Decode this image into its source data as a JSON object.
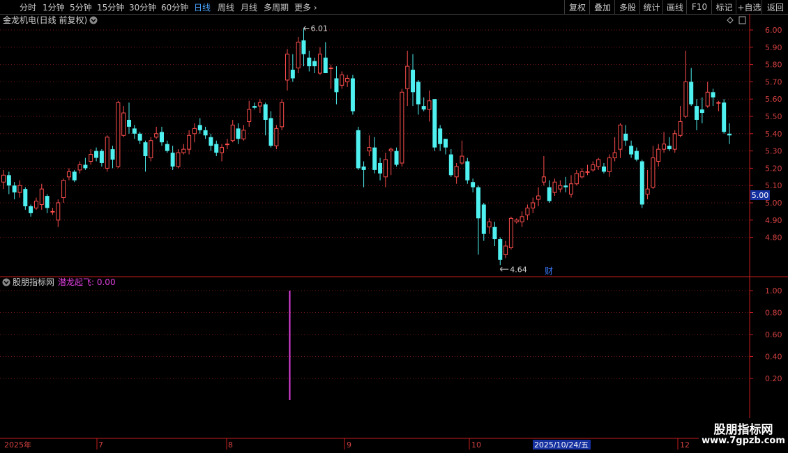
{
  "toolbar": {
    "periods": [
      "分时",
      "1分钟",
      "5分钟",
      "15分钟",
      "30分钟",
      "60分钟",
      "日线",
      "周线",
      "月线",
      "多周期"
    ],
    "active_period": "日线",
    "more_label": "更多",
    "actions": [
      "复权",
      "叠加",
      "多股",
      "统计",
      "画线",
      "F10",
      "标记",
      "+自选",
      "返回"
    ]
  },
  "main_panel": {
    "title": "金龙机电(日线 前复权)",
    "high_marker": "6.01",
    "low_marker": "4.64",
    "price_tag": "5.00",
    "finance_badge": "财"
  },
  "indicator_panel": {
    "title": "股朋指标网",
    "indicator_label": "潜龙起飞: 0.00",
    "indicator_color": "#e040e0"
  },
  "time_axis": {
    "labels": [
      "2025年",
      "7",
      "8",
      "9",
      "10",
      "12"
    ],
    "cursor_date": "2025/10/24/五"
  },
  "watermark": {
    "line1": "股朋指标网",
    "line2": "www.7gpzb.com"
  },
  "colors": {
    "up": "#ff4d4d",
    "down": "#4ff0f0",
    "axis_red": "#c81e1e",
    "grid": "#7a1a1a",
    "active_tab": "#4aa3ff"
  },
  "chart_data": [
    {
      "type": "candlestick",
      "title": "金龙机电(日线 前复权)",
      "y_ticks": [
        6.0,
        5.9,
        5.8,
        5.7,
        5.6,
        5.5,
        5.4,
        5.3,
        5.2,
        5.1,
        5.0,
        4.9,
        4.8
      ],
      "ylim": [
        4.61,
        6.03
      ],
      "annotations": [
        {
          "label": "6.01",
          "type": "high"
        },
        {
          "label": "4.64",
          "type": "low"
        }
      ],
      "candles": [
        [
          5.12,
          5.16,
          5.19,
          5.08
        ],
        [
          5.16,
          5.1,
          5.18,
          5.05
        ],
        [
          5.1,
          5.06,
          5.12,
          5.02
        ],
        [
          5.06,
          5.1,
          5.13,
          5.03
        ],
        [
          5.08,
          4.98,
          5.09,
          4.96
        ],
        [
          4.98,
          4.94,
          4.99,
          4.92
        ],
        [
          4.97,
          5.01,
          5.03,
          4.96
        ],
        [
          4.99,
          5.08,
          5.11,
          4.96
        ],
        [
          5.04,
          4.97,
          5.05,
          4.94
        ],
        [
          4.95,
          4.95,
          4.97,
          4.93
        ],
        [
          4.9,
          5.0,
          5.02,
          4.86
        ],
        [
          5.03,
          5.13,
          5.14,
          5.0
        ],
        [
          5.15,
          5.18,
          5.2,
          5.13
        ],
        [
          5.18,
          5.13,
          5.19,
          5.12
        ],
        [
          5.19,
          5.22,
          5.24,
          5.17
        ],
        [
          5.22,
          5.2,
          5.26,
          5.19
        ],
        [
          5.24,
          5.28,
          5.31,
          5.22
        ],
        [
          5.3,
          5.26,
          5.32,
          5.24
        ],
        [
          5.3,
          5.23,
          5.31,
          5.21
        ],
        [
          5.2,
          5.38,
          5.39,
          5.18
        ],
        [
          5.31,
          5.25,
          5.33,
          5.2
        ],
        [
          5.21,
          5.58,
          5.59,
          5.2
        ],
        [
          5.39,
          5.52,
          5.56,
          5.38
        ],
        [
          5.48,
          5.44,
          5.58,
          5.4
        ],
        [
          5.43,
          5.4,
          5.45,
          5.37
        ],
        [
          5.4,
          5.36,
          5.41,
          5.34
        ],
        [
          5.35,
          5.27,
          5.36,
          5.18
        ],
        [
          5.26,
          5.36,
          5.38,
          5.24
        ],
        [
          5.38,
          5.4,
          5.44,
          5.37
        ],
        [
          5.41,
          5.35,
          5.44,
          5.33
        ],
        [
          5.34,
          5.3,
          5.36,
          5.29
        ],
        [
          5.29,
          5.21,
          5.33,
          5.19
        ],
        [
          5.21,
          5.29,
          5.31,
          5.2
        ],
        [
          5.29,
          5.31,
          5.34,
          5.28
        ],
        [
          5.31,
          5.39,
          5.42,
          5.28
        ],
        [
          5.4,
          5.43,
          5.46,
          5.35
        ],
        [
          5.45,
          5.42,
          5.49,
          5.4
        ],
        [
          5.42,
          5.39,
          5.44,
          5.37
        ],
        [
          5.38,
          5.33,
          5.4,
          5.3
        ],
        [
          5.34,
          5.29,
          5.36,
          5.27
        ],
        [
          5.29,
          5.32,
          5.34,
          5.24
        ],
        [
          5.34,
          5.34,
          5.37,
          5.31
        ],
        [
          5.36,
          5.45,
          5.48,
          5.35
        ],
        [
          5.43,
          5.37,
          5.46,
          5.34
        ],
        [
          5.37,
          5.42,
          5.45,
          5.36
        ],
        [
          5.47,
          5.54,
          5.59,
          5.44
        ],
        [
          5.56,
          5.55,
          5.58,
          5.54
        ],
        [
          5.56,
          5.58,
          5.6,
          5.52
        ],
        [
          5.57,
          5.48,
          5.58,
          5.39
        ],
        [
          5.49,
          5.33,
          5.53,
          5.32
        ],
        [
          5.33,
          5.43,
          5.45,
          5.31
        ],
        [
          5.44,
          5.58,
          5.6,
          5.42
        ],
        [
          5.71,
          5.86,
          5.89,
          5.65
        ],
        [
          5.77,
          5.72,
          5.86,
          5.7
        ],
        [
          5.78,
          5.93,
          5.96,
          5.75
        ],
        [
          5.94,
          5.86,
          6.01,
          5.79
        ],
        [
          5.84,
          5.79,
          5.88,
          5.76
        ],
        [
          5.82,
          5.79,
          5.84,
          5.75
        ],
        [
          5.75,
          5.86,
          5.9,
          5.74
        ],
        [
          5.84,
          5.75,
          5.93,
          5.75
        ],
        [
          5.78,
          5.78,
          5.8,
          5.66
        ],
        [
          5.72,
          5.64,
          5.79,
          5.57
        ],
        [
          5.68,
          5.74,
          5.76,
          5.66
        ],
        [
          5.7,
          5.72,
          5.74,
          5.67
        ],
        [
          5.72,
          5.53,
          5.74,
          5.51
        ],
        [
          5.42,
          5.2,
          5.44,
          5.19
        ],
        [
          5.21,
          5.19,
          5.24,
          5.09
        ],
        [
          5.3,
          5.32,
          5.39,
          5.27
        ],
        [
          5.32,
          5.19,
          5.38,
          5.17
        ],
        [
          5.23,
          5.17,
          5.26,
          5.13
        ],
        [
          5.15,
          5.25,
          5.29,
          5.09
        ],
        [
          5.3,
          5.31,
          5.32,
          5.16
        ],
        [
          5.3,
          5.22,
          5.32,
          5.21
        ],
        [
          5.23,
          5.64,
          5.66,
          5.21
        ],
        [
          5.66,
          5.79,
          5.88,
          5.56
        ],
        [
          5.77,
          5.64,
          5.86,
          5.56
        ],
        [
          5.7,
          5.57,
          5.71,
          5.51
        ],
        [
          5.56,
          5.54,
          5.61,
          5.53
        ],
        [
          5.54,
          5.59,
          5.65,
          5.47
        ],
        [
          5.6,
          5.32,
          5.6,
          5.3
        ],
        [
          5.43,
          5.34,
          5.45,
          5.3
        ],
        [
          5.37,
          5.32,
          5.37,
          5.28
        ],
        [
          5.28,
          5.16,
          5.31,
          5.15
        ],
        [
          5.15,
          5.21,
          5.23,
          5.11
        ],
        [
          5.23,
          5.27,
          5.36,
          5.22
        ],
        [
          5.24,
          5.13,
          5.26,
          5.11
        ],
        [
          5.12,
          5.09,
          5.14,
          5.06
        ],
        [
          5.09,
          4.91,
          5.1,
          4.7
        ],
        [
          4.99,
          4.82,
          5.0,
          4.78
        ],
        [
          4.86,
          4.89,
          4.91,
          4.82
        ],
        [
          4.86,
          4.79,
          4.89,
          4.75
        ],
        [
          4.79,
          4.67,
          4.8,
          4.64
        ],
        [
          4.7,
          4.75,
          4.78,
          4.68
        ],
        [
          4.74,
          4.91,
          4.92,
          4.73
        ],
        [
          4.89,
          4.9,
          4.91,
          4.88
        ],
        [
          4.89,
          4.92,
          4.95,
          4.86
        ],
        [
          4.93,
          4.97,
          4.99,
          4.9
        ],
        [
          4.97,
          5.0,
          5.03,
          4.94
        ],
        [
          5.02,
          5.04,
          5.09,
          4.98
        ],
        [
          5.12,
          5.15,
          5.27,
          5.1
        ],
        [
          5.09,
          5.01,
          5.13,
          5.0
        ],
        [
          5.06,
          5.12,
          5.14,
          5.04
        ],
        [
          5.08,
          5.1,
          5.13,
          5.06
        ],
        [
          5.1,
          5.09,
          5.15,
          5.06
        ],
        [
          5.05,
          5.11,
          5.16,
          5.03
        ],
        [
          5.11,
          5.17,
          5.19,
          5.1
        ],
        [
          5.15,
          5.18,
          5.2,
          5.14
        ],
        [
          5.18,
          5.18,
          5.22,
          5.16
        ],
        [
          5.19,
          5.22,
          5.24,
          5.18
        ],
        [
          5.21,
          5.25,
          5.26,
          5.19
        ],
        [
          5.21,
          5.18,
          5.23,
          5.17
        ],
        [
          5.18,
          5.26,
          5.28,
          5.15
        ],
        [
          5.26,
          5.29,
          5.38,
          5.24
        ],
        [
          5.31,
          5.45,
          5.46,
          5.26
        ],
        [
          5.4,
          5.36,
          5.45,
          5.33
        ],
        [
          5.33,
          5.28,
          5.36,
          5.26
        ],
        [
          5.3,
          5.25,
          5.32,
          5.24
        ],
        [
          5.24,
          4.99,
          5.25,
          4.97
        ],
        [
          5.05,
          5.08,
          5.19,
          5.02
        ],
        [
          5.09,
          5.26,
          5.33,
          5.08
        ],
        [
          5.24,
          5.31,
          5.34,
          5.21
        ],
        [
          5.31,
          5.34,
          5.41,
          5.29
        ],
        [
          5.33,
          5.31,
          5.38,
          5.3
        ],
        [
          5.31,
          5.4,
          5.42,
          5.29
        ],
        [
          5.39,
          5.47,
          5.56,
          5.38
        ],
        [
          5.5,
          5.7,
          5.88,
          5.49
        ],
        [
          5.7,
          5.57,
          5.78,
          5.56
        ],
        [
          5.56,
          5.48,
          5.6,
          5.42
        ],
        [
          5.54,
          5.52,
          5.61,
          5.46
        ],
        [
          5.56,
          5.64,
          5.7,
          5.55
        ],
        [
          5.64,
          5.61,
          5.66,
          5.56
        ],
        [
          5.58,
          5.58,
          5.59,
          5.53
        ],
        [
          5.58,
          5.41,
          5.6,
          5.4
        ],
        [
          5.4,
          5.39,
          5.46,
          5.34
        ]
      ]
    },
    {
      "type": "bar",
      "title": "潜龙起飞",
      "y_ticks": [
        1.0,
        0.8,
        0.6,
        0.4,
        0.2
      ],
      "ylim": [
        0.0,
        1.05
      ],
      "signals": [
        {
          "candle_index": 53,
          "value": 1.0
        }
      ]
    }
  ]
}
